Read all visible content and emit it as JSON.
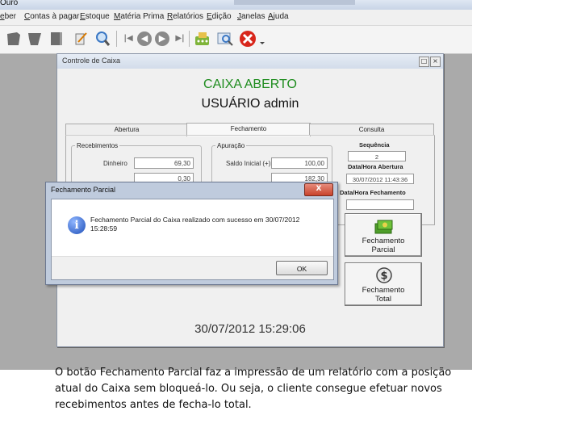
{
  "app": {
    "title": "Ouro"
  },
  "menu": [
    "eber",
    "Contas à pagar",
    "Estoque",
    "Matéria Prima",
    "Relatórios",
    "Edição",
    "Janelas",
    "Ajuda"
  ],
  "toolbar": {
    "icons": [
      "open-icon",
      "save-icon",
      "close-icon",
      "print-icon",
      "search-icon",
      "first-icon",
      "prev-icon",
      "next-icon",
      "last-icon",
      "calculator-icon",
      "preview-icon",
      "cancel-icon"
    ],
    "nav_symbols": {
      "first": "|◀",
      "prev": "◀",
      "next": "▶",
      "last": "▶|"
    }
  },
  "window": {
    "title": "Controle de Caixa",
    "status_line1": "CAIXA ABERTO",
    "status_line2": "USUÁRIO admin",
    "tabs": [
      "Abertura",
      "Fechamento",
      "Consulta"
    ],
    "active_tab": "Fechamento",
    "recebimentos": {
      "legend": "Recebimentos",
      "dinheiro_label": "Dinheiro",
      "dinheiro_value": "69,30",
      "cheque_value": "0,30"
    },
    "apuracao": {
      "legend": "Apuração",
      "saldo_label": "Saldo Inicial (+)",
      "saldo_value": "100,00",
      "second_value": "182,30"
    },
    "sequencia_label": "Sequência",
    "sequencia_value": "2",
    "abertura_label": "Data/Hora Abertura",
    "abertura_value": "30/07/2012 11:43:36",
    "fechamento_label": "Data/Hora Fechamento",
    "btn_parcial": "Fechamento\nParcial",
    "btn_total": "Fechamento\nTotal",
    "datetime": "30/07/2012 15:29:06"
  },
  "dialog": {
    "title": "Fechamento Parcial",
    "close": "X",
    "message": "Fechamento Parcial do Caixa realizado com sucesso em 30/07/2012 15:28:59",
    "ok": "OK"
  },
  "caption": "O botão Fechamento Parcial faz a impressão de um relatório com a posição atual do Caixa sem bloqueá-lo. Ou seja, o cliente consegue efetuar novos recebimentos antes de fecha-lo total.",
  "colors": {
    "status_green": "#1e8c1e",
    "dialog_close": "#c8432c",
    "info_blue": "#1f4fb8"
  }
}
